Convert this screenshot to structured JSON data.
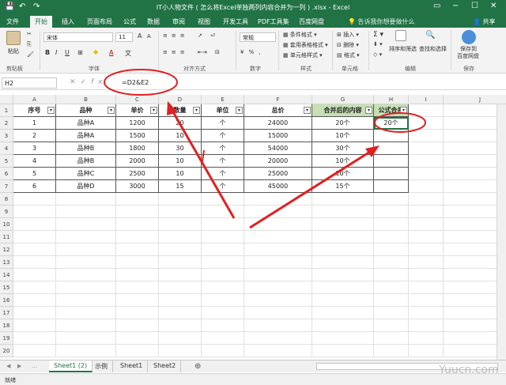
{
  "window": {
    "title": "IT小人物文件 ( 怎么将Excel单独两列内容合并为一列 ) .xlsx - Excel",
    "quick_access": [
      "↶",
      "↷"
    ],
    "controls": [
      "▭",
      "−",
      "☐",
      "✕"
    ]
  },
  "tabs": [
    "文件",
    "开始",
    "插入",
    "页面布局",
    "公式",
    "数据",
    "审阅",
    "视图",
    "开发工具",
    "PDF工具集",
    "百度网盘"
  ],
  "active_tab": "开始",
  "tellme": "告诉我你想要做什么",
  "share": "共享",
  "ribbon": {
    "clipboard": {
      "label": "剪贴板",
      "paste": "粘贴"
    },
    "font": {
      "label": "字体",
      "name": "宋体",
      "size": "11",
      "bold": "B",
      "italic": "I",
      "underline": "U",
      "grow": "A",
      "shrink": "A"
    },
    "alignment": {
      "label": "对齐方式"
    },
    "number": {
      "label": "数字",
      "format": "常规"
    },
    "styles": {
      "label": "样式",
      "items": [
        "条件格式",
        "套用表格格式",
        "单元格样式"
      ]
    },
    "cells": {
      "label": "单元格",
      "items": [
        "插入",
        "删除",
        "格式"
      ]
    },
    "editing": {
      "label": "编辑",
      "items": [
        "排序和筛选",
        "查找和选择"
      ]
    },
    "save": {
      "label": "保存",
      "items": [
        "保存到",
        "百度网盘"
      ]
    }
  },
  "formula_bar": {
    "name_box": "H2",
    "fx": "fx",
    "formula": "=D2&E2"
  },
  "columns": [
    "A",
    "B",
    "C",
    "D",
    "E",
    "F",
    "G",
    "H",
    "I",
    "J"
  ],
  "rows": [
    "1",
    "2",
    "3",
    "4",
    "5",
    "6",
    "7",
    "8",
    "9",
    "10",
    "11",
    "12",
    "13",
    "14",
    "15",
    "16",
    "17",
    "18",
    "19",
    "20",
    "21"
  ],
  "table": {
    "headers": [
      "序号",
      "品种",
      "单价",
      "数量",
      "单位",
      "总价",
      "合并后的内容",
      "公式合并"
    ],
    "rows": [
      [
        "1",
        "品种A",
        "1200",
        "20",
        "个",
        "24000",
        "20个",
        "20个"
      ],
      [
        "2",
        "品种A",
        "1500",
        "10",
        "个",
        "15000",
        "10个",
        ""
      ],
      [
        "3",
        "品种B",
        "1800",
        "30",
        "个",
        "54000",
        "30个",
        ""
      ],
      [
        "4",
        "品种B",
        "2000",
        "10",
        "个",
        "20000",
        "10个",
        ""
      ],
      [
        "5",
        "品种C",
        "2500",
        "10",
        "个",
        "25000",
        "10个",
        ""
      ],
      [
        "6",
        "品种D",
        "3000",
        "15",
        "个",
        "45000",
        "15个",
        ""
      ]
    ]
  },
  "sheets": [
    "Sheet1 (2)",
    "示例",
    "Sheet1",
    "Sheet2"
  ],
  "active_sheet": "Sheet1 (2)",
  "status": {
    "ready": "就绪"
  },
  "watermark": "Yuucn.com",
  "colors": {
    "excel_green": "#217346",
    "annotation_red": "#e02020",
    "header_green": "#c6e0b4"
  }
}
